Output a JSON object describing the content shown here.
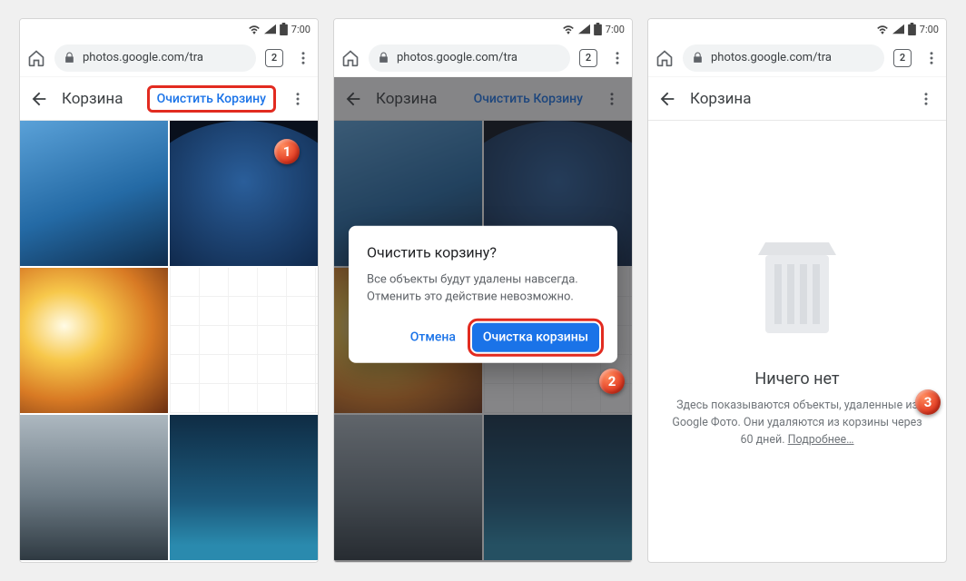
{
  "status": {
    "time": "7:00"
  },
  "chrome": {
    "url_display": "photos.google.com/tra",
    "tab_count": "2"
  },
  "header": {
    "title": "Корзина",
    "action_clear": "Очистить Корзину"
  },
  "dialog": {
    "title": "Очистить корзину?",
    "body": "Все объекты будут удалены навсегда. Отменить это действие невозможно.",
    "cancel": "Отмена",
    "confirm": "Очистка корзины"
  },
  "empty": {
    "title": "Ничего нет",
    "description": "Здесь показываются объекты, удаленные из Google Фото. Они удаляются из корзины через 60 дней. ",
    "more": "Подробнее…"
  },
  "badges": {
    "one": "1",
    "two": "2",
    "three": "3"
  }
}
